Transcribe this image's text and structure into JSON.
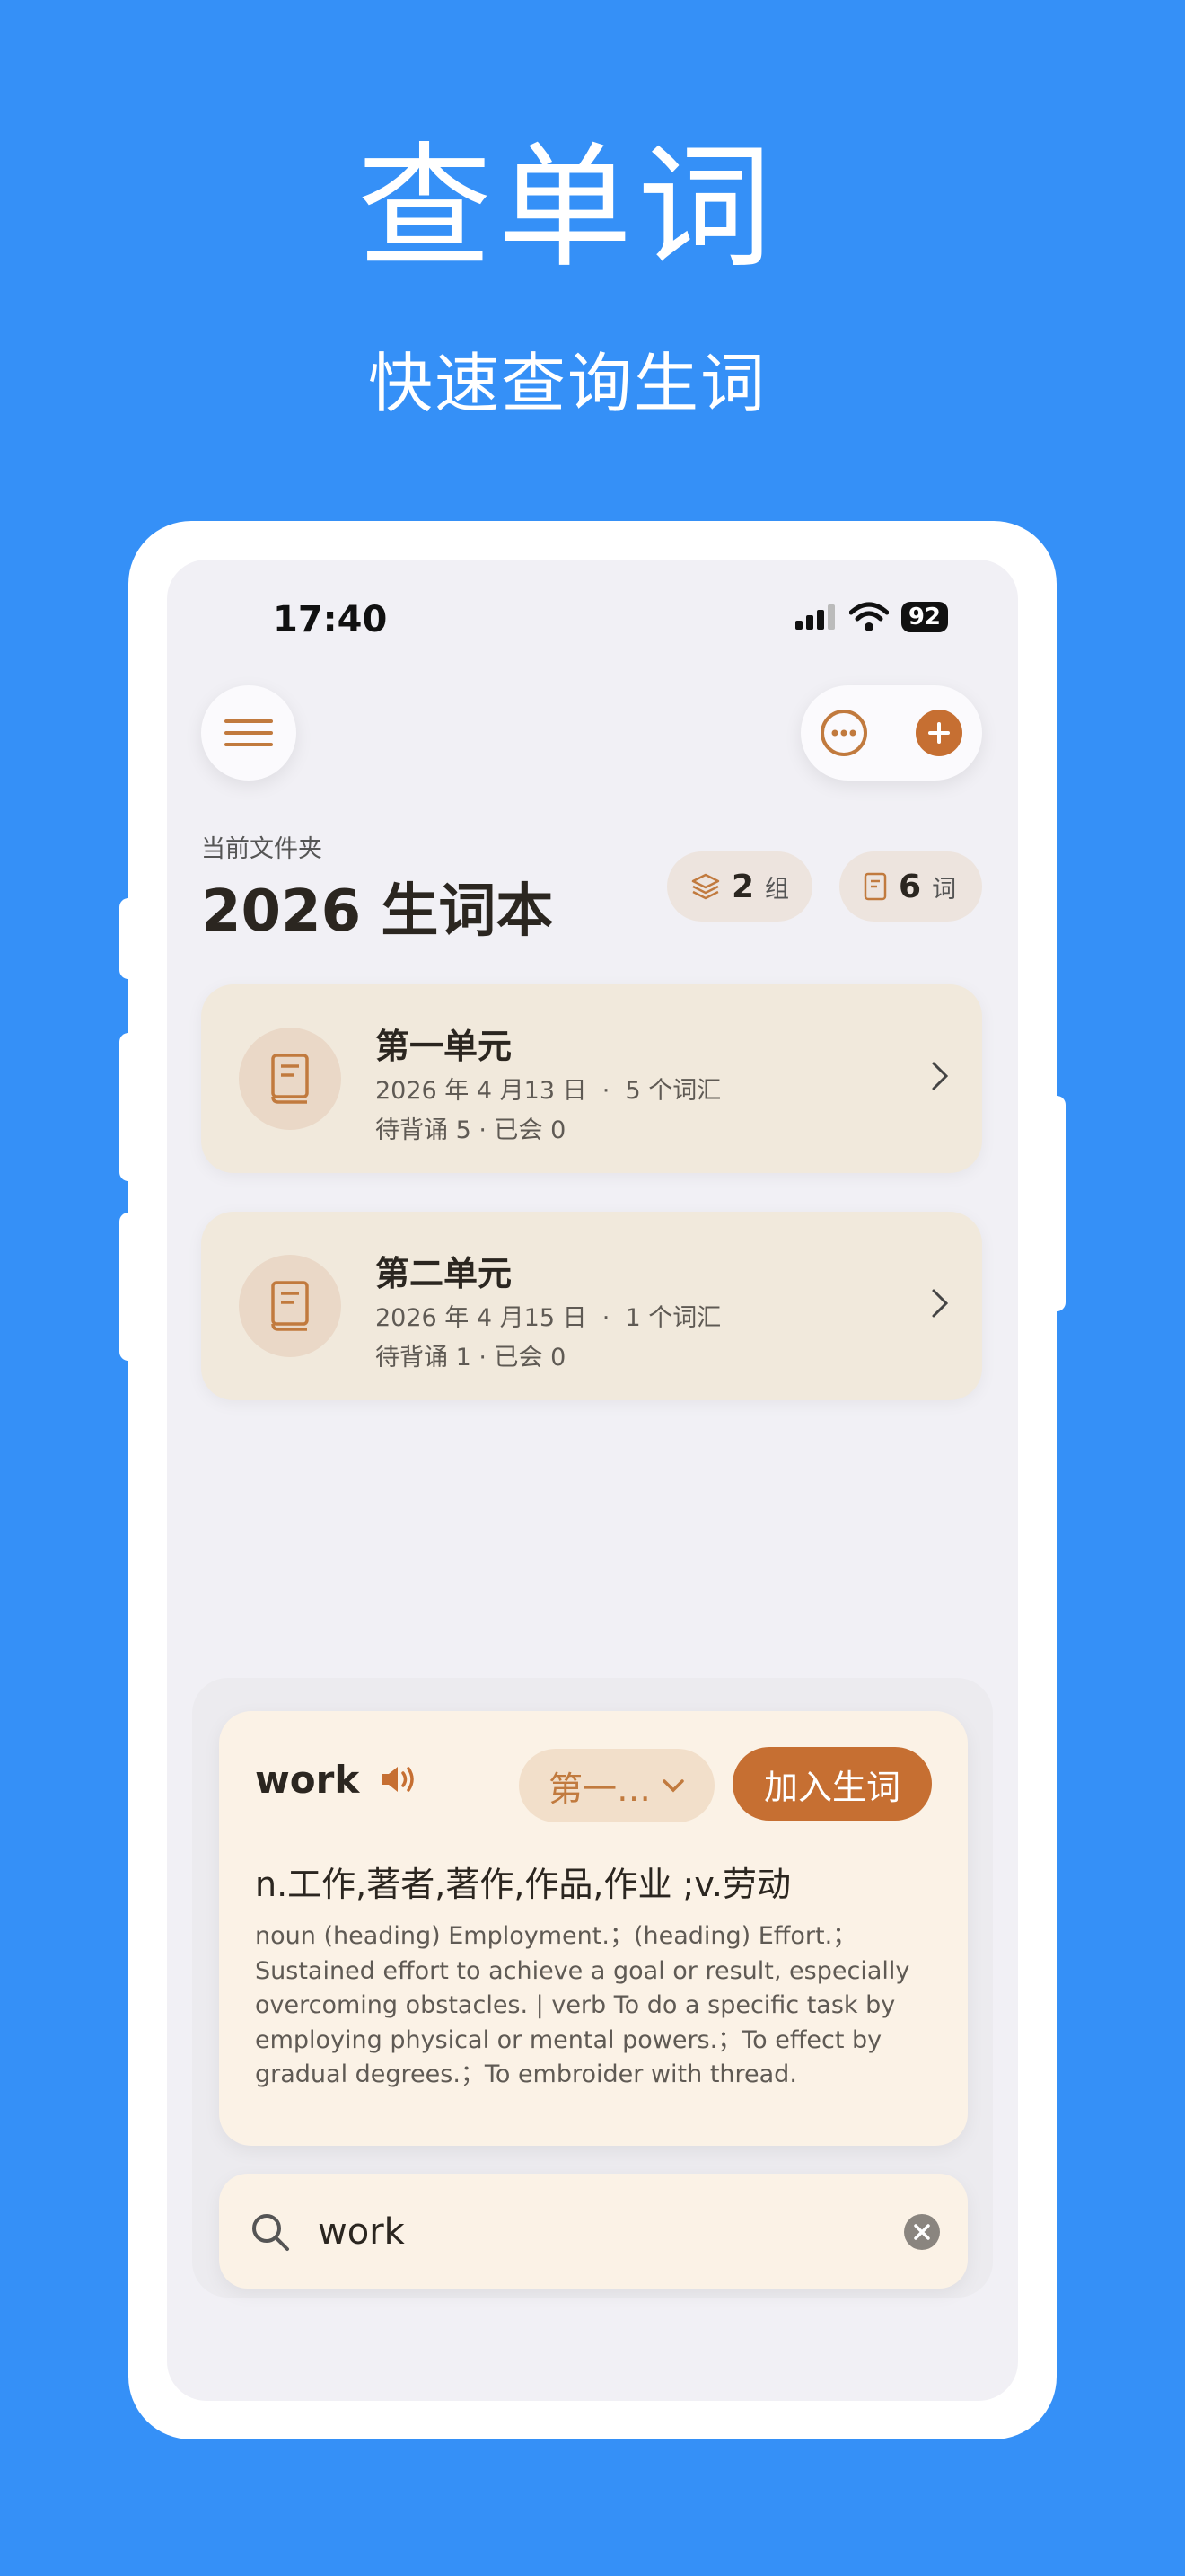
{
  "hero": {
    "title": "查单词",
    "subtitle": "快速查询生词"
  },
  "status_bar": {
    "time": "17:40",
    "battery": "92"
  },
  "folder": {
    "label": "当前文件夹",
    "name": "2026 生词本"
  },
  "stats": {
    "groups": {
      "count": "2",
      "unit": "组",
      "icon": "layers-icon"
    },
    "words": {
      "count": "6",
      "unit": "词",
      "icon": "notebook-icon"
    }
  },
  "units": [
    {
      "title": "第一单元",
      "meta": "2026 年 4 月13 日  ·  5 个词汇",
      "progress": "待背诵 5 · 已会 0",
      "icon": "book-icon"
    },
    {
      "title": "第二单元",
      "meta": "2026 年 4 月15 日  ·  1 个词汇",
      "progress": "待背诵 1 · 已会 0",
      "icon": "book-icon"
    }
  ],
  "lookup": {
    "word": "work",
    "group_select": "第一…",
    "add_button": "加入生词",
    "short_definition": "n.工作,著者,著作,作品,作业 ;v.劳动",
    "long_definition": "noun (heading) Employment.；(heading) Effort.；Sustained effort to achieve a goal or result, especially overcoming obstacles. | verb To do a specific task by employing physical or mental powers.；To effect by gradual degrees.；To embroider with thread."
  },
  "search": {
    "value": "work"
  },
  "colors": {
    "background": "#3590f7",
    "accent": "#c66f32",
    "card": "#f1e9dc"
  }
}
